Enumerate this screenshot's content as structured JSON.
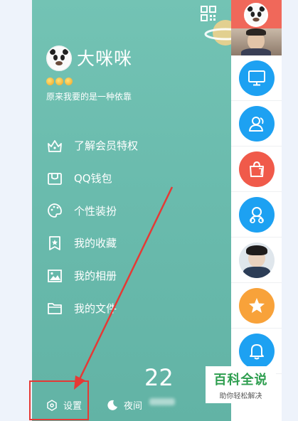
{
  "profile": {
    "nickname": "大咪咪",
    "signature": "原来我要的是一种依靠",
    "level_suns": 3
  },
  "menu": {
    "items": [
      {
        "label": "了解会员特权",
        "icon": "crown-icon"
      },
      {
        "label": "QQ钱包",
        "icon": "wallet-icon"
      },
      {
        "label": "个性装扮",
        "icon": "palette-icon"
      },
      {
        "label": "我的收藏",
        "icon": "star-bookmark-icon"
      },
      {
        "label": "我的相册",
        "icon": "photo-icon"
      },
      {
        "label": "我的文件",
        "icon": "folder-icon"
      }
    ]
  },
  "bottom": {
    "settings_label": "设置",
    "night_label": "夜间",
    "temperature": "22"
  },
  "watermark": {
    "title": "百科全说",
    "subtitle": "助你轻松解决"
  },
  "colors": {
    "drawer_bg": "#6bbcae",
    "accent_blue": "#1da1f2",
    "accent_red": "#f05a4a",
    "accent_orange": "#f8a23a",
    "highlight_red": "#e53935"
  },
  "rightbar": {
    "icons": [
      "monitor-icon",
      "contacts-icon",
      "shopping-bag-icon",
      "group-icon",
      "user-photo",
      "star-icon",
      "bell-icon"
    ]
  }
}
